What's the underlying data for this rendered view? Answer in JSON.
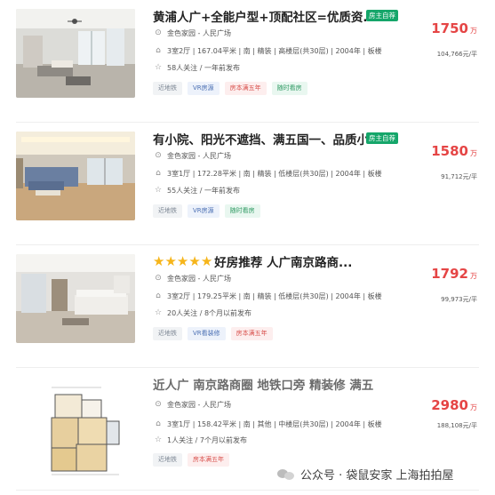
{
  "listings": [
    {
      "title": "黄浦人广+全能户型+顶配社区=优质资...",
      "badge": "房主自荐",
      "community": "金色家园 - 人民广场",
      "details": "3室2厅 | 167.04平米 | 南 | 精装 | 高楼层(共30层) | 2004年 | 板楼",
      "followers": "58人关注 / 一年前发布",
      "tags": [
        "近地铁",
        "VR房源",
        "房本满五年",
        "随时看房"
      ],
      "price": "1750",
      "price_unit": "万",
      "unit_price": "104,766元/平",
      "photo_type": "living-room-photo"
    },
    {
      "title": "有小院、阳光不遮挡、满五国一、品质小...",
      "badge": "房主自荐",
      "community": "金色家园 - 人民广场",
      "details": "3室1厅 | 172.28平米 | 南 | 精装 | 低楼层(共30层) | 2004年 | 板楼",
      "followers": "55人关注 / 一年前发布",
      "tags": [
        "近地铁",
        "VR房源",
        "随时看房"
      ],
      "price": "1580",
      "price_unit": "万",
      "unit_price": "91,712元/平",
      "photo_type": "living-room-photo"
    },
    {
      "title": "好房推荐 人广南京路商...",
      "stars": 5,
      "community": "金色家园 - 人民广场",
      "details": "3室2厅 | 179.25平米 | 南 | 精装 | 低楼层(共30层) | 2004年 | 板楼",
      "followers": "20人关注 / 8个月以前发布",
      "tags": [
        "近地铁",
        "VR看装修",
        "房本满五年"
      ],
      "price": "1792",
      "price_unit": "万",
      "unit_price": "99,973元/平",
      "photo_type": "living-room-photo"
    },
    {
      "title": "近人广 南京路商圈 地铁口旁 精装修 满五",
      "community": "金色家园 - 人民广场",
      "details": "3室1厅 | 158.42平米 | 南 | 其他 | 中楼层(共30层) | 2004年 | 板楼",
      "followers": "1人关注 / 7个月以前发布",
      "tags": [
        "近地铁",
        "房本满五年"
      ],
      "price": "2980",
      "price_unit": "万",
      "unit_price": "188,108元/平",
      "photo_type": "floor-plan"
    }
  ],
  "watermark": "公众号 · 袋鼠安家 上海拍拍屋",
  "colors": {
    "price": "#e54545",
    "badge": "#15a66a",
    "star": "#f6b51a"
  },
  "icons": {
    "community": "location-pin-icon",
    "details": "house-icon",
    "followers": "star-outline-icon"
  }
}
